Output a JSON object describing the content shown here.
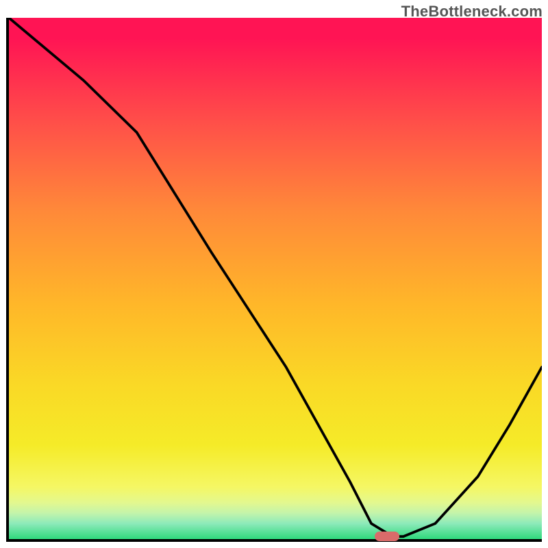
{
  "watermark": "TheBottleneck.com",
  "colors": {
    "gradient_top": "#ff1454",
    "gradient_bottom": "#2fd97c",
    "axis": "#000000",
    "curve": "#000000",
    "marker": "#d96b6a"
  },
  "chart_data": {
    "type": "line",
    "title": "",
    "xlabel": "",
    "ylabel": "",
    "xlim": [
      0,
      100
    ],
    "ylim": [
      0,
      100
    ],
    "series": [
      {
        "name": "bottleneck-curve",
        "x": [
          0,
          14,
          24,
          38,
          52,
          64,
          68,
          72,
          74,
          80,
          88,
          94,
          100
        ],
        "values": [
          100,
          88,
          78,
          55,
          33,
          11,
          3,
          0.5,
          0.5,
          3,
          12,
          22,
          33
        ]
      }
    ],
    "annotations": [
      {
        "name": "optimal-marker",
        "x": 71,
        "y": 0.5
      }
    ]
  }
}
